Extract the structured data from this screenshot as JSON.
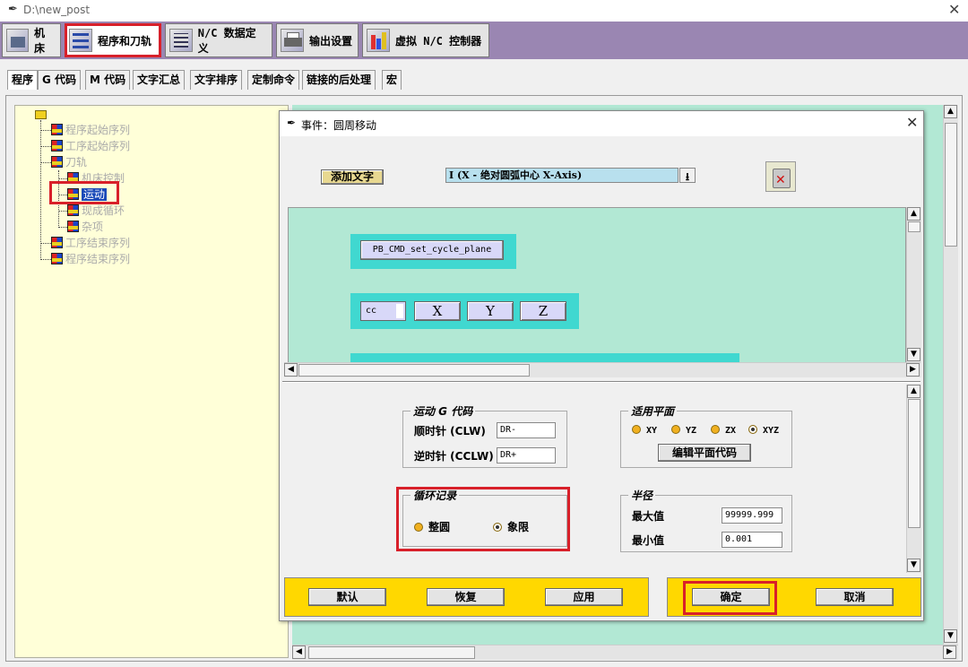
{
  "window": {
    "title": "D:\\new_post"
  },
  "top_tabs": [
    {
      "label": "机床"
    },
    {
      "label": "程序和刀轨"
    },
    {
      "label": "N/C 数据定义"
    },
    {
      "label": "输出设置"
    },
    {
      "label": "虚拟 N/C 控制器"
    }
  ],
  "sub_tabs": [
    "程序",
    "G 代码",
    "M 代码",
    "文字汇总",
    "文字排序",
    "定制命令",
    "链接的后处理",
    "宏"
  ],
  "tree": {
    "items": [
      "程序起始序列",
      "工序起始序列",
      "刀轨",
      "机床控制",
      "运动",
      "现成循环",
      "杂项",
      "工序结束序列",
      "程序结束序列"
    ]
  },
  "dialog": {
    "title": "事件：圆周移动",
    "add_word_label": "添加文字",
    "address_value": "I (X - 绝对圆弧中心 X-Axis)",
    "cycle_plane_block": "PB_CMD_set_cycle_plane",
    "cc_field": "cc",
    "axis_buttons": [
      "X",
      "Y",
      "Z"
    ],
    "motion_group": {
      "title": "运动 G 代码",
      "cw_label": "顺时针 (CLW)",
      "cw_value": "DR-",
      "ccw_label": "逆时针 (CCLW)",
      "ccw_value": "DR+"
    },
    "plane_group": {
      "title": "适用平面",
      "options": [
        "XY",
        "YZ",
        "ZX",
        "XYZ"
      ],
      "selected": "XYZ",
      "edit_button": "编辑平面代码"
    },
    "circle_group": {
      "title": "循环记录",
      "options": [
        "整圆",
        "象限"
      ],
      "selected": "象限"
    },
    "radius_group": {
      "title": "半径",
      "max_label": "最大值",
      "max_value": "99999.999",
      "min_label": "最小值",
      "min_value": "0.001"
    },
    "buttons": {
      "default": "默认",
      "restore": "恢复",
      "apply": "应用",
      "ok": "确定",
      "cancel": "取消"
    }
  },
  "colors": {
    "accent_purple": "#9a86b2",
    "mint": "#b2e8d4",
    "cyan": "#40d8d0",
    "yellow": "#ffd800",
    "tree_bg": "#ffffd8",
    "highlight_red": "#d8202a"
  }
}
